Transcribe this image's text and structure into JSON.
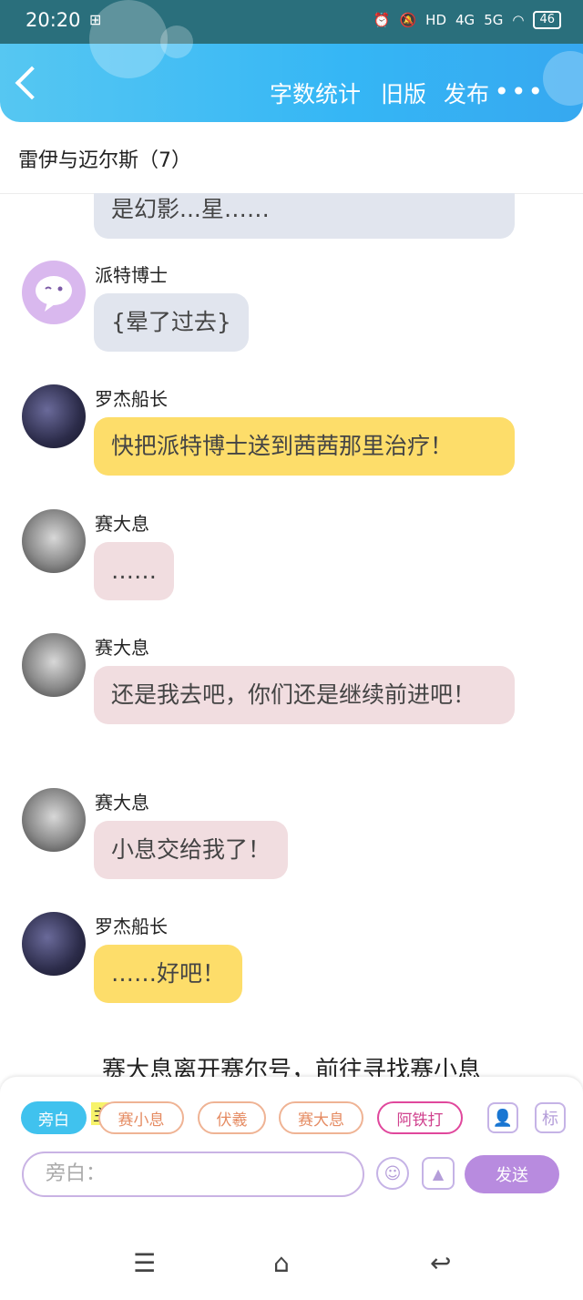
{
  "status_bar": {
    "time": "20:20",
    "network_labels": [
      "HD",
      "4G",
      "5G"
    ],
    "battery": "46"
  },
  "header": {
    "word_count": "字数统计",
    "old_version": "旧版",
    "publish": "发布",
    "more": "•••"
  },
  "title": "雷伊与迈尔斯（7）",
  "messages": [
    {
      "name": "",
      "text": "是幻影...星……",
      "color": "gray"
    },
    {
      "name": "派特博士",
      "text": "{晕了过去}",
      "color": "gray",
      "avatar": "purple-chat-avatar"
    },
    {
      "name": "罗杰船长",
      "text": "快把派特博士送到茜茜那里治疗！",
      "color": "yellow",
      "avatar": "captain-avatar"
    },
    {
      "name": "赛大息",
      "text": "……",
      "color": "pink",
      "avatar": "saidaxi-avatar"
    },
    {
      "name": "赛大息",
      "text": "还是我去吧，你们还是继续前进吧！",
      "color": "pink",
      "avatar": "saidaxi-avatar"
    },
    {
      "name": "赛大息",
      "text": "小息交给我了！",
      "color": "pink",
      "avatar": "saidaxi-avatar"
    },
    {
      "name": "罗杰船长",
      "text": "……好吧！",
      "color": "yellow",
      "avatar": "captain-avatar"
    }
  ],
  "narration": "赛大息离开赛尔号，前往寻找赛小息",
  "characters": {
    "active": "旁白",
    "main_tag": "主",
    "list": [
      "赛小息",
      "伏羲",
      "赛大息",
      "阿铁打"
    ],
    "mark_label": "标"
  },
  "input": {
    "placeholder": "旁白："
  },
  "send_label": "发送",
  "colors": {
    "header": "#35b6f5",
    "bubble_gray": "#e1e5ee",
    "bubble_yellow": "#fddd6a",
    "bubble_pink": "#f1dde0",
    "send": "#b88bdf"
  }
}
